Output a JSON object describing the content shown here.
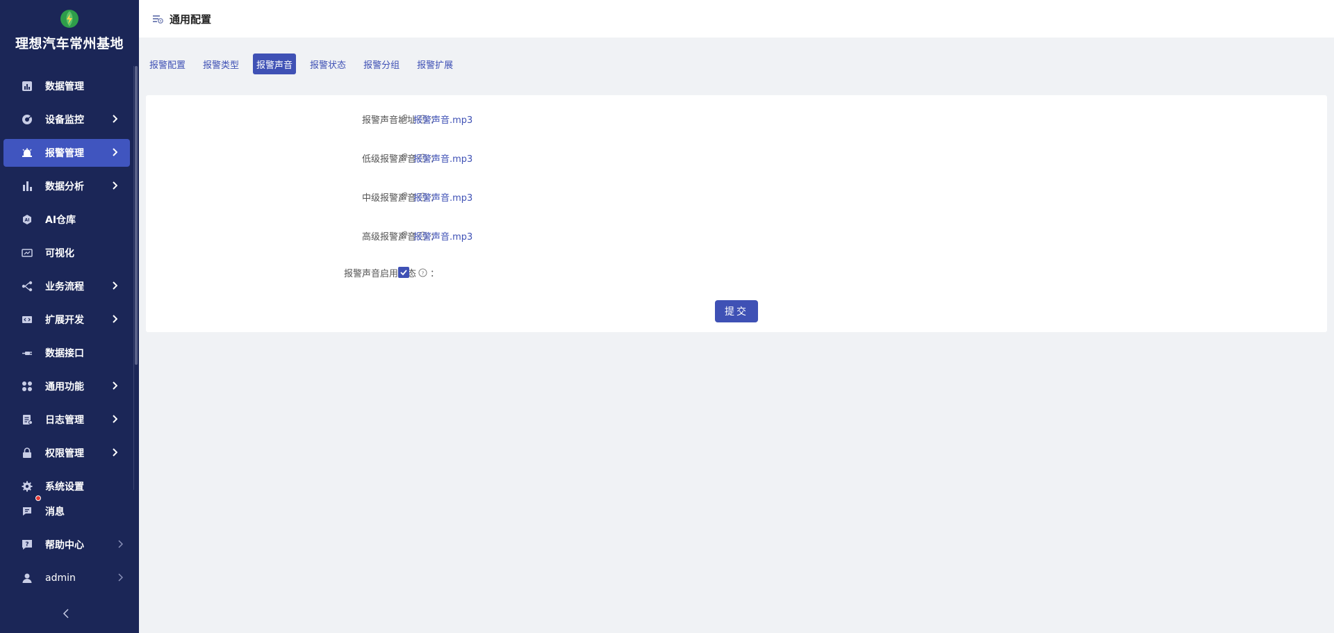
{
  "brand": {
    "title": "理想汽车常州基地",
    "logo_icon": "lightning-leaf-logo"
  },
  "sidebar": {
    "items": [
      {
        "label": "数据管理",
        "icon": "dashboard-icon",
        "has_arrow": false
      },
      {
        "label": "设备监控",
        "icon": "monitor-icon",
        "has_arrow": true
      },
      {
        "label": "报警管理",
        "icon": "alarm-icon",
        "has_arrow": true,
        "active": true
      },
      {
        "label": "数据分析",
        "icon": "bar-chart-icon",
        "has_arrow": true
      },
      {
        "label": "AI仓库",
        "icon": "ai-icon",
        "has_arrow": false
      },
      {
        "label": "可视化",
        "icon": "screen-icon",
        "has_arrow": false
      },
      {
        "label": "业务流程",
        "icon": "flow-icon",
        "has_arrow": true
      },
      {
        "label": "扩展开发",
        "icon": "code-icon",
        "has_arrow": true
      },
      {
        "label": "数据接口",
        "icon": "plug-icon",
        "has_arrow": false
      },
      {
        "label": "通用功能",
        "icon": "grid-icon",
        "has_arrow": true
      },
      {
        "label": "日志管理",
        "icon": "log-icon",
        "has_arrow": true
      },
      {
        "label": "权限管理",
        "icon": "lock-icon",
        "has_arrow": true
      },
      {
        "label": "系统设置",
        "icon": "gear-icon",
        "has_arrow": false
      },
      {
        "label": "消息",
        "icon": "message-icon",
        "has_arrow": false
      },
      {
        "label": "帮助中心",
        "icon": "help-icon",
        "has_arrow": true
      },
      {
        "label": "admin",
        "icon": "user-icon",
        "has_arrow": true
      }
    ]
  },
  "header": {
    "title": "通用配置",
    "icon": "config-icon"
  },
  "tabs": [
    {
      "label": "报警配置"
    },
    {
      "label": "报警类型"
    },
    {
      "label": "报警声音",
      "active": true
    },
    {
      "label": "报警状态"
    },
    {
      "label": "报警分组"
    },
    {
      "label": "报警扩展"
    }
  ],
  "form": {
    "fields": [
      {
        "label": "报警声音地址",
        "file": "报警声音.mp3"
      },
      {
        "label": "低级报警声音",
        "file": "报警声音.mp3"
      },
      {
        "label": "中级报警声音",
        "file": "报警声音.mp3"
      },
      {
        "label": "高级报警声音",
        "file": "报警声音.mp3"
      }
    ],
    "enable": {
      "label": "报警声音启用状态",
      "checked": true
    },
    "colon": "：",
    "submit_label": "提交"
  },
  "colors": {
    "sidebar_bg": "#1b2657",
    "accent": "#3f51b5",
    "active_menu": "#4055bf",
    "page_bg": "#f0f2f5"
  }
}
